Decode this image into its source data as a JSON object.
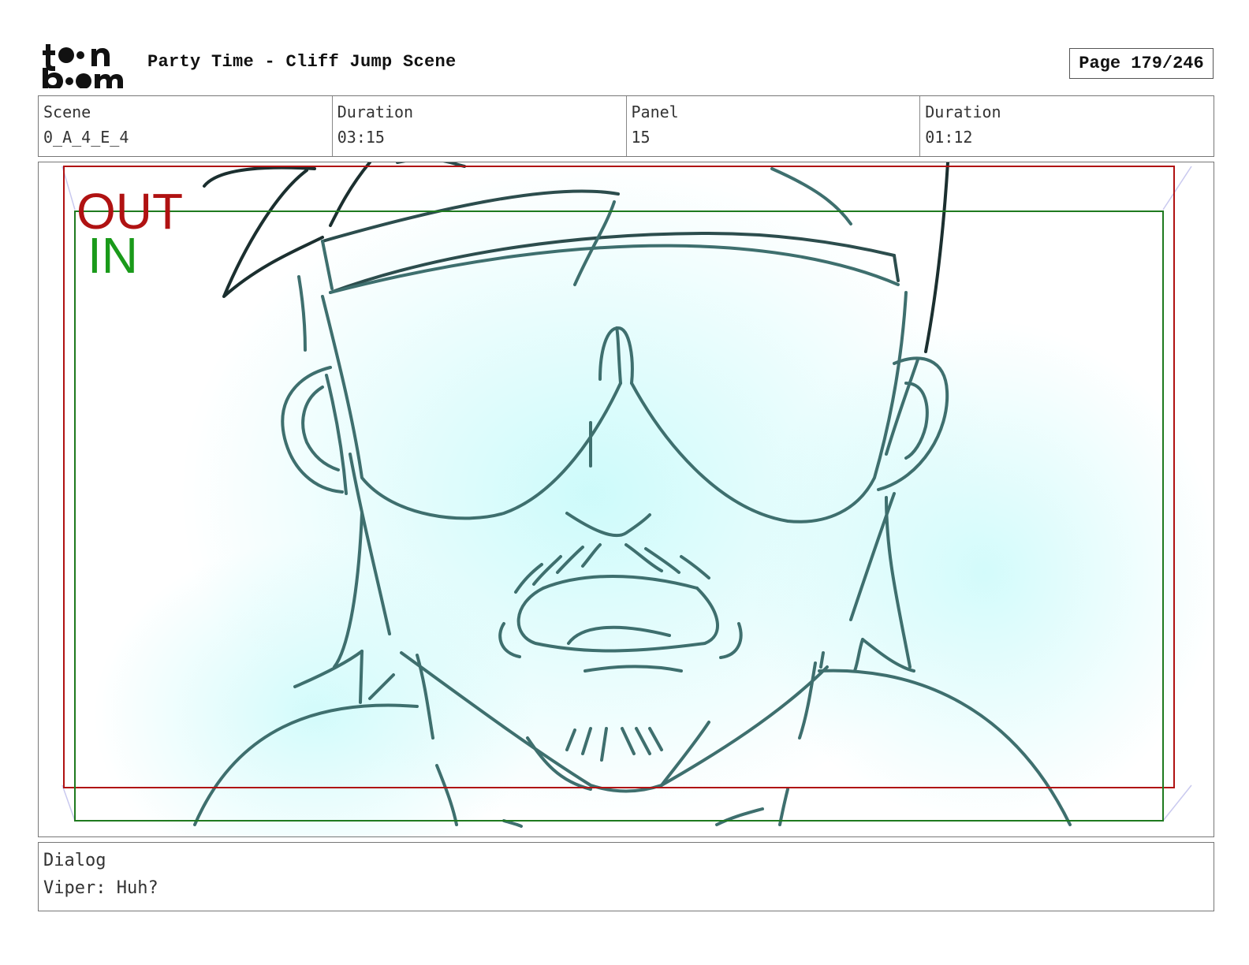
{
  "header": {
    "logo_text": "toon boom",
    "title": "Party Time - Cliff Jump Scene",
    "page": "Page 179/246"
  },
  "info": {
    "scene_label": "Scene",
    "scene_value": "0_A_4_E_4",
    "scene_duration_label": "Duration",
    "scene_duration_value": "03:15",
    "panel_label": "Panel",
    "panel_value": "15",
    "panel_duration_label": "Duration",
    "panel_duration_value": "01:12"
  },
  "panel": {
    "out_label": "OUT",
    "in_label": "IN",
    "out_color": "#b01212",
    "in_color": "#1a9a1a",
    "background_tint": "#c8fafa",
    "line_color": "#3a6a6a"
  },
  "dialog": {
    "label": "Dialog",
    "text": "Viper: Huh?"
  }
}
